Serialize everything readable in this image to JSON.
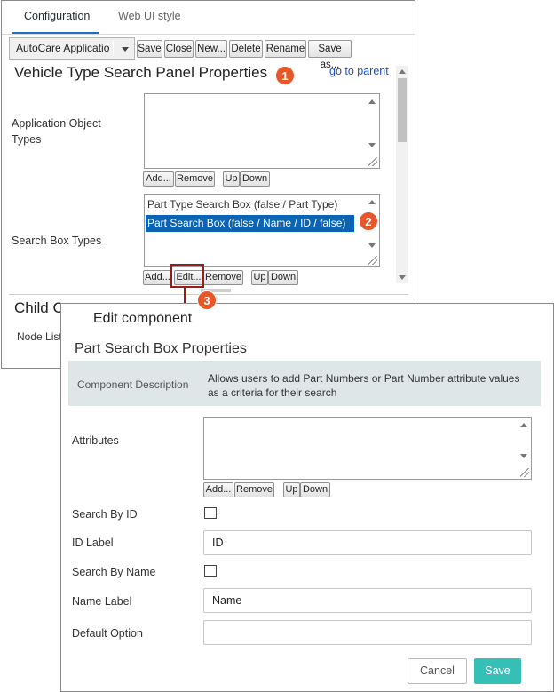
{
  "tabs": {
    "configuration": "Configuration",
    "web_ui_style": "Web UI style"
  },
  "toolbar": {
    "select_value": "AutoCare Applicatio",
    "save": "Save",
    "close": "Close",
    "new": "New...",
    "delete": "Delete",
    "rename": "Rename",
    "save_as": "Save as..."
  },
  "panel": {
    "title": "Vehicle Type Search Panel Properties",
    "goto_parent": "go to parent",
    "application_object_types_label": "Application Object Types",
    "search_box_types_label": "Search Box Types",
    "search_box_items": [
      "Part Type Search Box (false / Part Type)",
      "Part Search Box (false / Name / ID / false)"
    ],
    "buttons": {
      "add": "Add...",
      "edit": "Edit...",
      "remove": "Remove",
      "up": "Up",
      "down": "Down"
    },
    "child_title": "Child C",
    "node_list": "Node List"
  },
  "badges": [
    "1",
    "2",
    "3"
  ],
  "dialog": {
    "title": "Edit component",
    "subtitle": "Part Search Box Properties",
    "component_description_label": "Component Description",
    "component_description": "Allows users to add Part Numbers or Part Number attribute values as a criteria for their search",
    "attributes_label": "Attributes",
    "buttons": {
      "add": "Add...",
      "remove": "Remove",
      "up": "Up",
      "down": "Down"
    },
    "search_by_id_label": "Search By ID",
    "search_by_id_checked": false,
    "id_label_label": "ID Label",
    "id_label_value": "ID",
    "search_by_name_label": "Search By Name",
    "search_by_name_checked": false,
    "name_label_label": "Name Label",
    "name_label_value": "Name",
    "default_option_label": "Default Option",
    "default_option_value": "",
    "cancel": "Cancel",
    "save": "Save"
  },
  "colors": {
    "accent": "#1e6fc6",
    "badge": "#e8562a",
    "selection": "#0a63b5",
    "highlight": "#9b1b1b",
    "save_button": "#36bfb6",
    "description_bg": "#dfe6e8"
  }
}
